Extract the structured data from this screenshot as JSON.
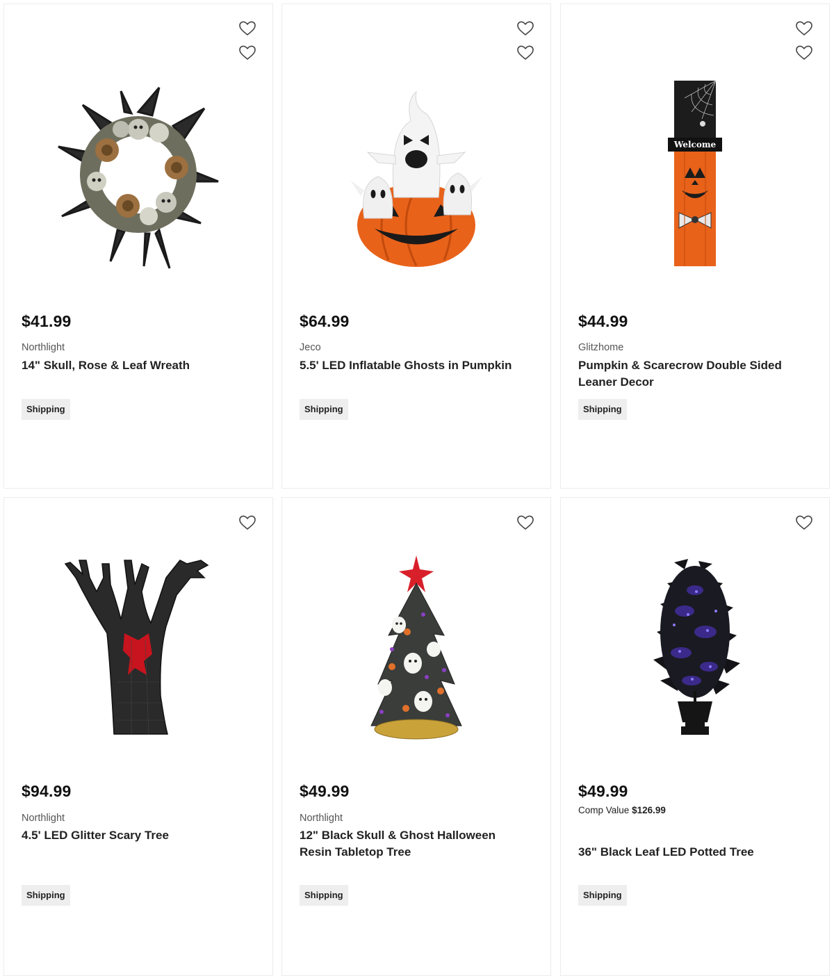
{
  "shipping_label": "Shipping",
  "products": [
    {
      "price": "$41.99",
      "brand": "Northlight",
      "title": "14\" Skull, Rose & Leaf Wreath",
      "icon": "heart-icon",
      "image": "skull-rose-wreath"
    },
    {
      "price": "$64.99",
      "brand": "Jeco",
      "title": "5.5' LED Inflatable Ghosts in Pumpkin",
      "icon": "heart-icon",
      "image": "inflatable-ghosts-pumpkin"
    },
    {
      "price": "$44.99",
      "brand": "Glitzhome",
      "title": "Pumpkin & Scarecrow Double Sided Leaner Decor",
      "icon": "heart-icon",
      "image": "pumpkin-leaner",
      "sign_text": "Welcome"
    },
    {
      "price": "$94.99",
      "brand": "Northlight",
      "title": "4.5' LED Glitter Scary Tree",
      "icon": "heart-icon",
      "image": "scary-tree"
    },
    {
      "price": "$49.99",
      "brand": "Northlight",
      "title": "12\" Black Skull & Ghost Halloween Resin Tabletop Tree",
      "icon": "heart-icon",
      "image": "tabletop-tree"
    },
    {
      "price": "$49.99",
      "comp_label": "Comp Value",
      "comp_value": "$126.99",
      "title": "36\" Black Leaf LED Potted Tree",
      "icon": "heart-icon",
      "image": "potted-tree"
    }
  ],
  "colors": {
    "pumpkin_orange": "#e8621a",
    "tile_border": "#ececec",
    "shipping_badge_bg": "#eeeeee",
    "accent_red": "#c8141e"
  }
}
